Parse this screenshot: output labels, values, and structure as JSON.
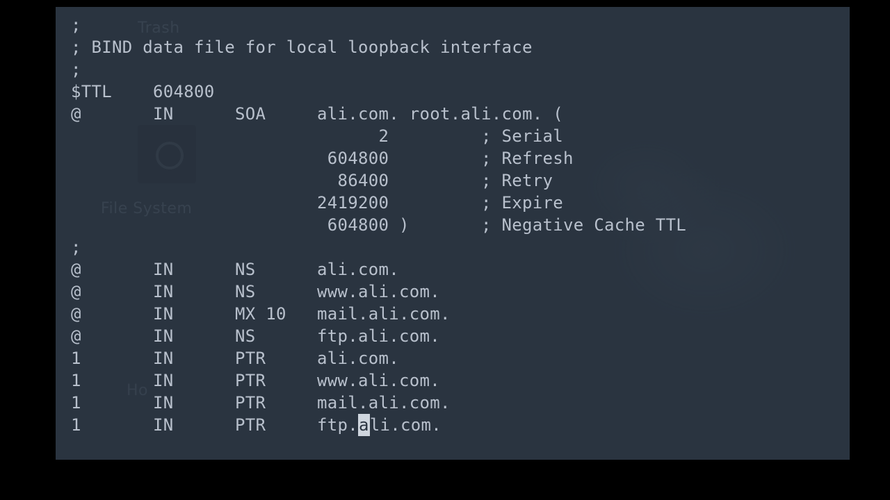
{
  "terminal": {
    "lines": [
      ";",
      "; BIND data file for local loopback interface",
      ";",
      "$TTL    604800",
      "@       IN      SOA     ali.com. root.ali.com. (",
      "                              2         ; Serial",
      "                         604800         ; Refresh",
      "                          86400         ; Retry",
      "                        2419200         ; Expire",
      "                         604800 )       ; Negative Cache TTL",
      ";",
      "@       IN      NS      ali.com.",
      "@       IN      NS      www.ali.com.",
      "@       IN      MX 10   mail.ali.com.",
      "@       IN      NS      ftp.ali.com.",
      "1       IN      PTR     ali.com.",
      "1       IN      PTR     www.ali.com.",
      "1       IN      PTR     mail.ali.com."
    ],
    "cursor_line": {
      "before": "1       IN      PTR     ftp.",
      "at": "a",
      "after": "li.com."
    }
  },
  "desktop": {
    "trash_label": "Trash",
    "filesystem_label": "File System",
    "home_label": "Ho"
  }
}
